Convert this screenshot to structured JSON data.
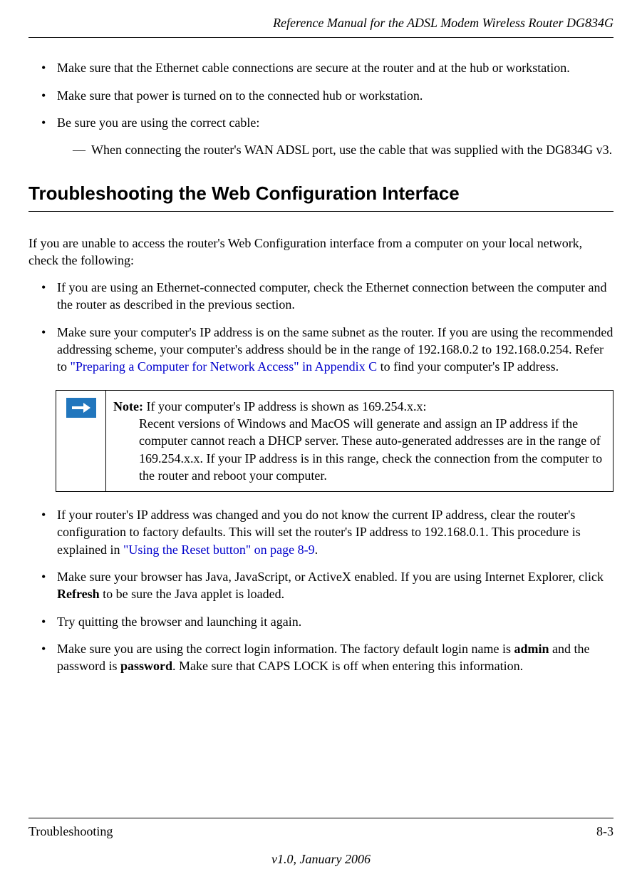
{
  "header": {
    "title": "Reference Manual for the ADSL Modem Wireless Router DG834G"
  },
  "top_bullets": {
    "b1": "Make sure that the Ethernet cable connections are secure at the router and at the hub or workstation.",
    "b2": "Make sure that power is turned on to the connected hub or workstation.",
    "b3": "Be sure you are using the correct cable:",
    "b3_sub": "When connecting the router's WAN ADSL port, use the cable that was supplied with the DG834G v3."
  },
  "section": {
    "heading": "Troubleshooting the Web Configuration Interface",
    "intro": "If you are unable to access the router's Web Configuration interface from a computer on your local network, check the following:"
  },
  "bullets": {
    "b1": "If you are using an Ethernet-connected computer, check the Ethernet connection between the computer and the router as described in the previous section.",
    "b2_pre": "Make sure your computer's IP address is on the same subnet as the router. If you are using the recommended addressing scheme, your computer's address should be in the range of 192.168.0.2 to 192.168.0.254. Refer to ",
    "b2_link": "\"Preparing a Computer for Network Access\" in Appendix C",
    "b2_post": " to find your computer's IP address.",
    "b3_pre": "If your router's IP address was changed and you do not know the current IP address, clear the router's configuration to factory defaults. This will set the router's IP address to 192.168.0.1. This procedure is explained in ",
    "b3_link": "\"Using the Reset button\" on page 8-9",
    "b3_post": ".",
    "b4_pre": "Make sure your browser has Java, JavaScript, or ActiveX enabled. If you are using Internet Explorer, click ",
    "b4_bold": "Refresh",
    "b4_post": " to be sure the Java applet is loaded.",
    "b5": "Try quitting the browser and launching it again.",
    "b6_pre": "Make sure you are using the correct login information. The factory default login name is ",
    "b6_bold1": "admin",
    "b6_mid": " and the password is ",
    "b6_bold2": "password",
    "b6_post": ". Make sure that CAPS LOCK is off when entering this information."
  },
  "note": {
    "label": "Note: ",
    "line1": "If your computer's IP address is shown as 169.254.x.x:",
    "body": "Recent versions of Windows and MacOS will generate and assign an IP address if the computer cannot reach a DHCP server. These auto-generated addresses are in the range of 169.254.x.x. If your IP address is in this range, check the connection from the computer to the router and reboot your computer."
  },
  "footer": {
    "section_name": "Troubleshooting",
    "page_number": "8-3",
    "version": "v1.0, January 2006"
  }
}
